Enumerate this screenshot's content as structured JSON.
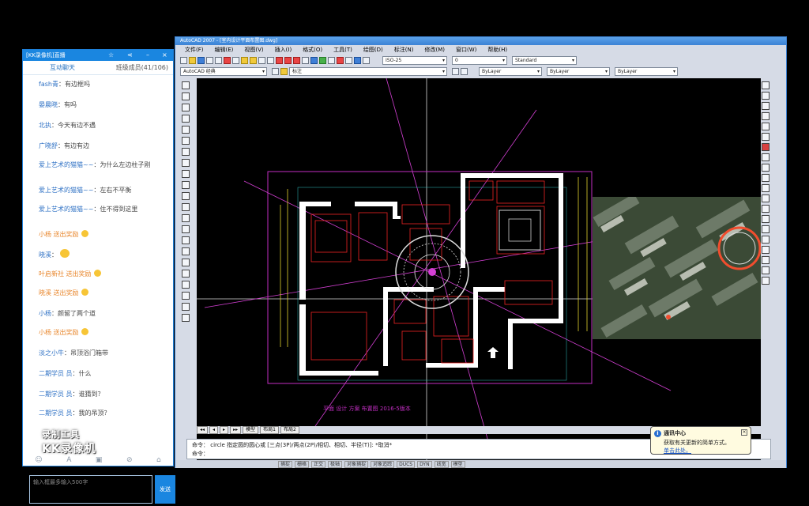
{
  "chat": {
    "title": "[KK录像机]直播",
    "tab_interact": "互动聊天",
    "tab_count": "班级成员(41/106)",
    "messages": [
      {
        "name": "fash青",
        "text": "：有边框吗"
      },
      {
        "name": "晏晨晓",
        "text": "：有吗"
      },
      {
        "name": "北执",
        "text": "：今天有边不遇"
      },
      {
        "name": "广晓舒",
        "text": "：有边有边"
      },
      {
        "name": "爱上艺术的猫猫~~",
        "text": "：为什么左边柱子刚"
      },
      {
        "name": "爱上艺术的猫猫~~",
        "text": "：左右不平衡"
      },
      {
        "name": "爱上艺术的猫猫~~",
        "text": "：住不得到这里"
      },
      {
        "name": "",
        "text": "小杨 送出奖励",
        "sys": true,
        "emo": true
      },
      {
        "name": "晓溪",
        "text": "：",
        "emo": true,
        "big": true
      },
      {
        "name": "",
        "text": "叶启新社 送出奖励",
        "sys": true,
        "emo": true
      },
      {
        "name": "",
        "text": "晓溪 送出奖励",
        "sys": true,
        "emo": true
      },
      {
        "name": "小杨",
        "text": "：颜留了两个道"
      },
      {
        "name": "",
        "text": "小杨 送出奖励",
        "sys": true,
        "emo": true
      },
      {
        "name": "淡之小牛",
        "text": "：吊顶浴门箱带"
      },
      {
        "name": "二期学员 员",
        "text": "：什么"
      },
      {
        "name": "二期学员 员",
        "text": "：谁猜到？"
      },
      {
        "name": "二期学员 员",
        "text": "：我的吊顶？"
      }
    ],
    "watermark_line1": "录制工具",
    "watermark_line2": "KK录像机",
    "input_placeholder": "输入框最多输入500字",
    "send_label": "发送",
    "icons": [
      "smile-icon",
      "font-icon",
      "image-icon",
      "ban-icon",
      "gift-icon"
    ]
  },
  "cad": {
    "title": "AutoCAD 2007 - [室内设计平面布置图.dwg]",
    "menu": [
      "文件(F)",
      "编辑(E)",
      "视图(V)",
      "插入(I)",
      "格式(O)",
      "工具(T)",
      "绘图(D)",
      "标注(N)",
      "修改(M)",
      "窗口(W)",
      "帮助(H)"
    ],
    "workspace": "AutoCAD 经典",
    "layer": "0",
    "text_style": "Standard",
    "dim_style": "ISO-25",
    "layer2": "标注",
    "color": "ByLayer",
    "linetype": "ByLayer",
    "lineweight": "ByLayer",
    "sheet_tabs": [
      "模型",
      "布局1",
      "布局2"
    ],
    "cmd_line1": "命令： circle 指定圆的圆心或 [三点(3P)/两点(2P)/相切、相切、半径(T)]: *取消*",
    "cmd_line2": "命令：",
    "drawing_caption": "平面 设计 方案 布置图 2016-5版本",
    "status_items": [
      "捕捉",
      "栅格",
      "正交",
      "极轴",
      "对象捕捉",
      "对象追踪",
      "DUCS",
      "DYN",
      "线宽",
      "模型"
    ]
  },
  "balloon": {
    "title": "通讯中心",
    "text": "获取有关更新的简单方式。",
    "link": "单击此处。"
  }
}
